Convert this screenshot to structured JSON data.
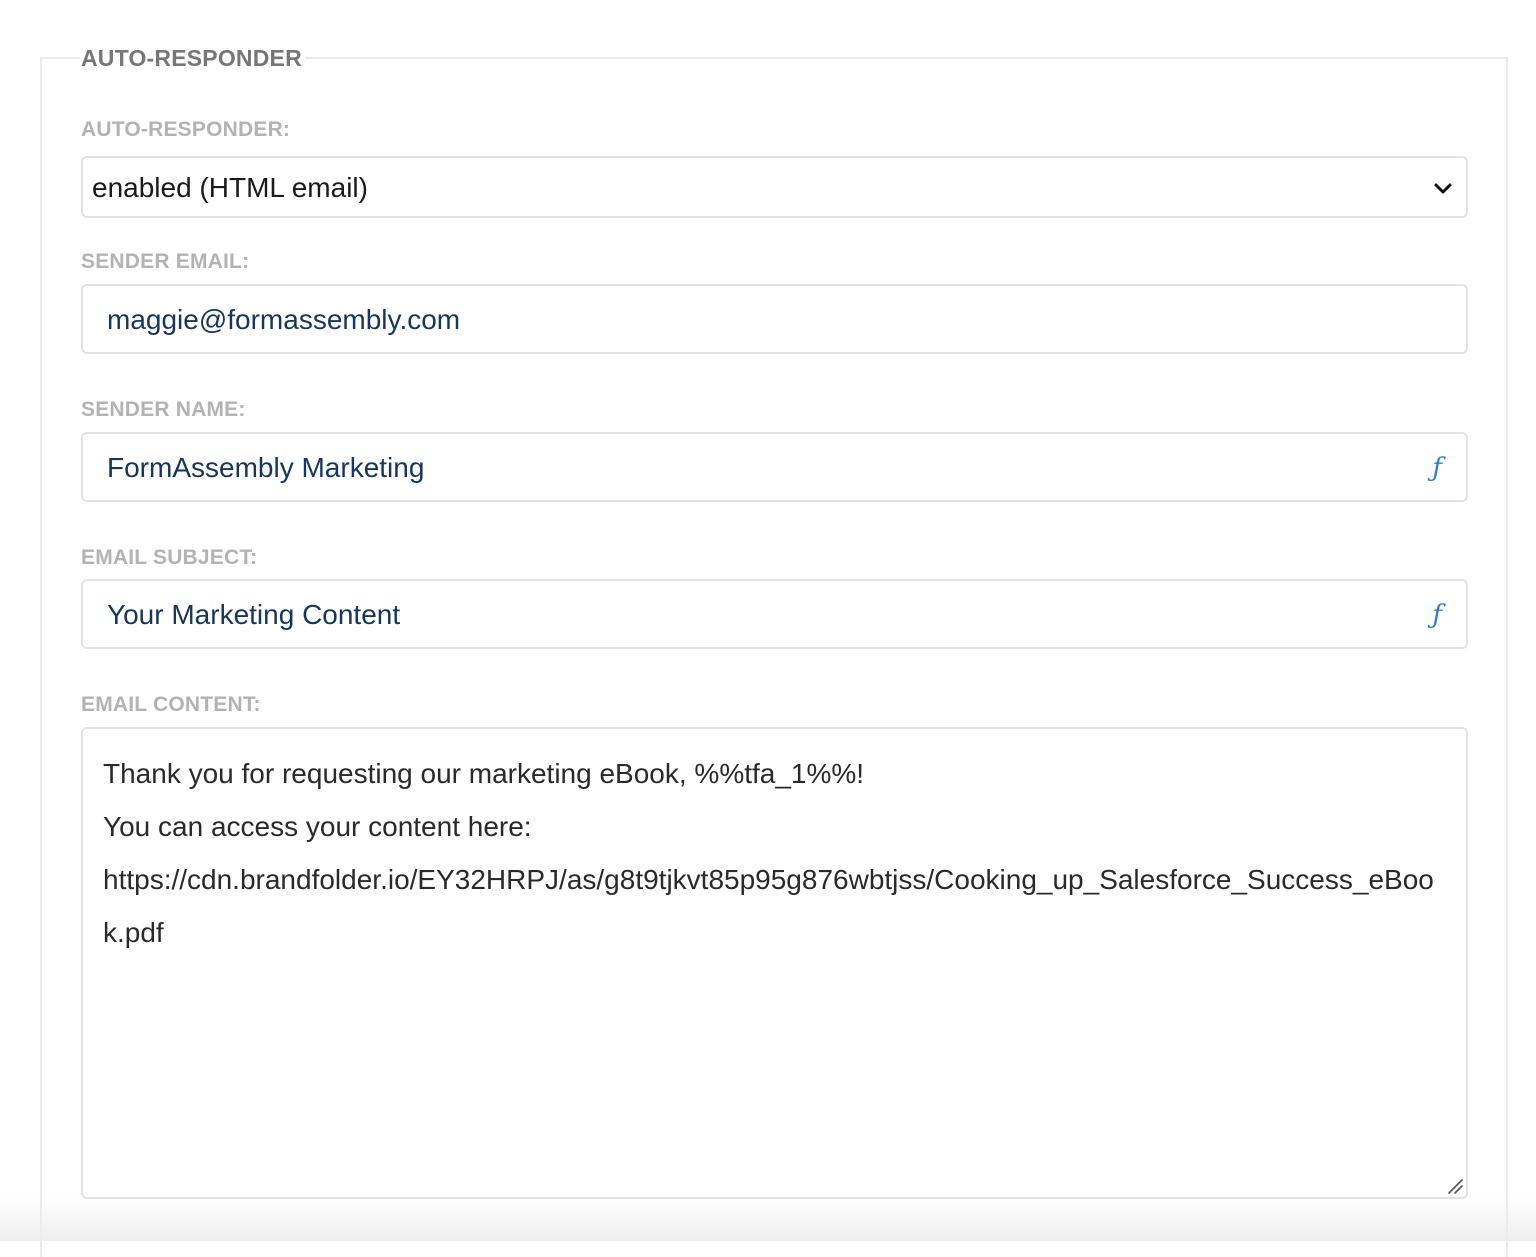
{
  "section": {
    "legend": "AUTO-RESPONDER"
  },
  "auto_responder": {
    "label": "AUTO-RESPONDER:",
    "selected_value": "enabled (HTML email)",
    "dropdown_icon": "chevron-down-icon"
  },
  "sender_email": {
    "label": "SENDER EMAIL:",
    "value": "maggie@formassembly.com"
  },
  "sender_name": {
    "label": "SENDER NAME:",
    "value": "FormAssembly Marketing",
    "formula_icon": "ƒ"
  },
  "email_subject": {
    "label": "EMAIL SUBJECT:",
    "value": "Your Marketing Content",
    "formula_icon": "ƒ"
  },
  "email_content": {
    "label": "EMAIL CONTENT:",
    "lines": [
      "Thank you for requesting our marketing eBook, %%tfa_1%%!",
      "You can access your content here:",
      "https://cdn.brandfolder.io/EY32HRPJ/as/g8t9tjkvt85p95g876wbtjss/Cooking_up_Salesforce_Success_eBook.pdf"
    ]
  },
  "colors": {
    "label_gray": "#b3b3b3",
    "legend_gray": "#777777",
    "input_text_navy": "#17365d",
    "formula_icon_blue": "#2a7fd4",
    "border_gray": "#e2e2e2"
  }
}
